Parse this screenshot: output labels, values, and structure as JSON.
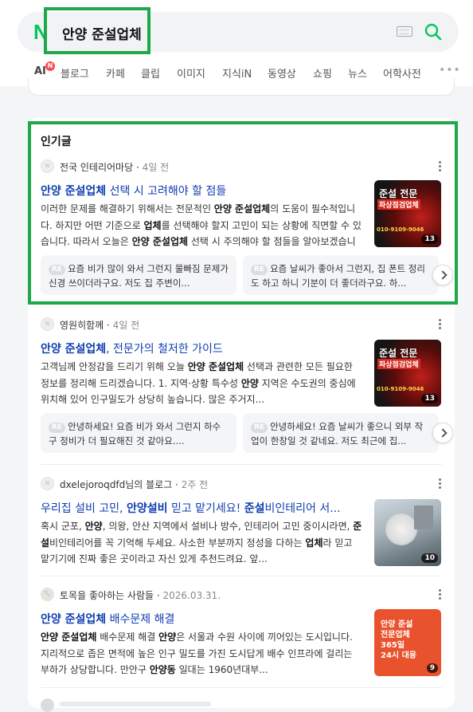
{
  "search": {
    "logo": "N",
    "query": "안양 준설업체"
  },
  "tabs": [
    {
      "label": "AI",
      "badge": "N"
    },
    {
      "label": "블로그"
    },
    {
      "label": "카페"
    },
    {
      "label": "클립"
    },
    {
      "label": "이미지"
    },
    {
      "label": "지식iN"
    },
    {
      "label": "동영상"
    },
    {
      "label": "쇼핑"
    },
    {
      "label": "뉴스"
    },
    {
      "label": "어학사전"
    }
  ],
  "colors": {
    "accent": "#03c75a",
    "highlight": "#1fa84a",
    "title_link": "#0f3eb0"
  },
  "popular": {
    "section_title": "인기글",
    "items": [
      {
        "author": "전국 인테리어마당",
        "date": "4일 전",
        "title_pre": "",
        "title_bold": "안양 준설업체",
        "title_post": " 선택 시 고려해야 할 점들",
        "snippet_parts": [
          "이러한 문제를 해결하기 위해서는 전문적인 ",
          "안양 준설업체",
          "의 도움이 필수적입니다. 하지만 어떤 기준으로 ",
          "업체",
          "를 선택해야 할지 고민이 되는 상황에 직면할 수 있습니다. 따라서 오늘은 ",
          "안양 준설업체",
          " 선택 시 주의해야 할 점들을 알아보겠습니다."
        ],
        "thumb": {
          "line1": "준설 전문",
          "line2": "파상점검업체",
          "phone": "010-9109-9046",
          "count": "13"
        },
        "reply_badge": "RE",
        "replies": [
          "요즘 비가 많이 와서 그런지 물빠짐 문제가 신경 쓰이더라구요. 저도 집 주변이...",
          "요즘 날씨가 좋아서 그런지, 집 폰트 정리도 하고 하니 기분이 더 좋더라구요. 하..."
        ]
      },
      {
        "author": "영원히함께",
        "date": "4일 전",
        "title_pre": "",
        "title_bold": "안양 준설업체",
        "title_post": ", 전문가의 철저한 가이드",
        "snippet_parts": [
          "고객님께 안정감을 드리기 위해 오늘 ",
          "안양 준설업체",
          " 선택과 관련한 모든 필요한 정보를 정리해 드리겠습니다. 1. 지역·상황 특수성 ",
          "안양",
          " 지역은 수도권의 중심에 위치해 있어 인구밀도가 상당히 높습니다. 많은 주거지..."
        ],
        "thumb": {
          "line1": "준설 전문",
          "line2": "파상점검업체",
          "phone": "010-9109-9046",
          "count": "13"
        },
        "reply_badge": "RE",
        "replies": [
          "안녕하세요! 요즘 비가 와서 그런지 하수구 정비가 더 필요해진 것 같아요....",
          "안녕하세요! 요즘 날씨가 좋으니 외부 작업이 한창일 것 같네요. 저도 최근에 집..."
        ]
      },
      {
        "author": "dxelejoroqdfd님의 블로그",
        "date": "2주 전",
        "title_pre": "우리집 설비 고민, ",
        "title_bold": "안양설비",
        "title_post": " 믿고 맡기세요! ",
        "title_bold2": "준설",
        "title_post2": "비인테리어 서...",
        "snippet_parts": [
          "혹시 군포, ",
          "안양",
          ", 의왕, 안산 지역에서 설비나 방수, 인테리어 고민 중이시라면, ",
          "준설",
          "비인테리어를 꼭 기억해 두세요. 사소한 부분까지 정성을 다하는 ",
          "업체",
          "라 믿고 맡기기에 진짜 좋은 곳이라고 자신 있게 추천드려요. 앞..."
        ],
        "thumb": {
          "count": "10"
        }
      },
      {
        "author": "토목을 좋아하는 사람들",
        "date": "2026.03.31.",
        "title_pre": "",
        "title_bold": "안양 준설업체",
        "title_post": " 배수문제 해결",
        "snippet_parts": [
          "",
          "안양 준설업체",
          " 배수문제 해결 ",
          "안양",
          "은 서울과 수원 사이에 끼어있는 도시입니다. 지리적으로 좁은 면적에 높은 인구 밀도를 가진 도시답게 배수 인프라에 걸리는 부하가 상당합니다. 만안구 ",
          "안양동",
          " 일대는 1960년대부..."
        ],
        "thumb": {
          "line1": "안양 준설",
          "line2": "전문업체",
          "line3": "365일",
          "line4": "24시 대응",
          "count": "9"
        }
      }
    ]
  }
}
